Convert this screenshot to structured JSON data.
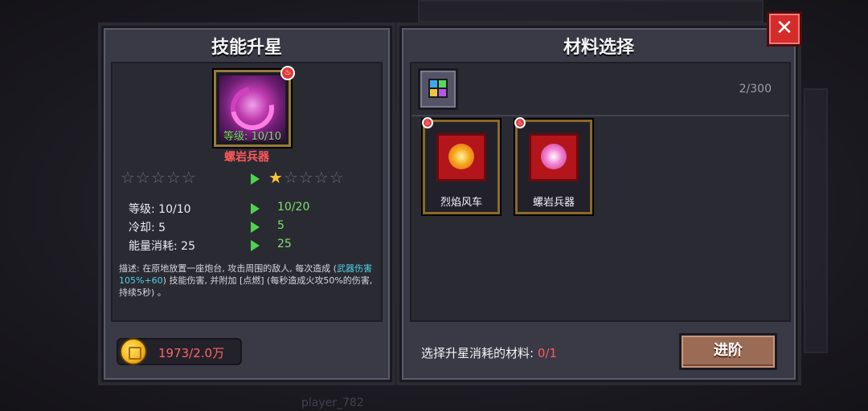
{
  "skill_panel": {
    "title": "技能升星",
    "skill_name": "螺岩兵器",
    "skill_level_label": "等级: 10/10",
    "current_stars": 0,
    "next_stars": 1,
    "max_stars": 5,
    "stats": [
      {
        "label": "等级: 10/10",
        "next": "10/20"
      },
      {
        "label": "冷却: 5",
        "next": "5"
      },
      {
        "label": "能量消耗: 25",
        "next": "25"
      }
    ],
    "description_prefix": "描述: 在原地放置一座炮台, 攻击周围的敌人, 每次造成 (",
    "description_highlight": "武器伤害105%+60",
    "description_suffix": ") 技能伤害, 并附加 [点燃] (每秒造成火攻50%的伤害, 持续5秒) 。",
    "gold": "1973/2.0万"
  },
  "material_panel": {
    "title": "材料选择",
    "count": "2/300",
    "items": [
      {
        "name": "烈焰风车"
      },
      {
        "name": "螺岩兵器"
      }
    ],
    "select_label": "选择升星消耗的材料:",
    "select_count": "0/1",
    "advance_label": "进阶"
  },
  "close_label": "✕",
  "background": {
    "player_label": "player_782"
  },
  "colors": {
    "green": "#7de36a",
    "red": "#ff5a5a",
    "gold_frame": "#8a6a2a",
    "panel": "#3a3946"
  },
  "icons": {
    "fire_badge": "flame-icon",
    "coin": "gold-coin-icon",
    "filter": "grid-filter-icon",
    "close": "close-icon"
  }
}
